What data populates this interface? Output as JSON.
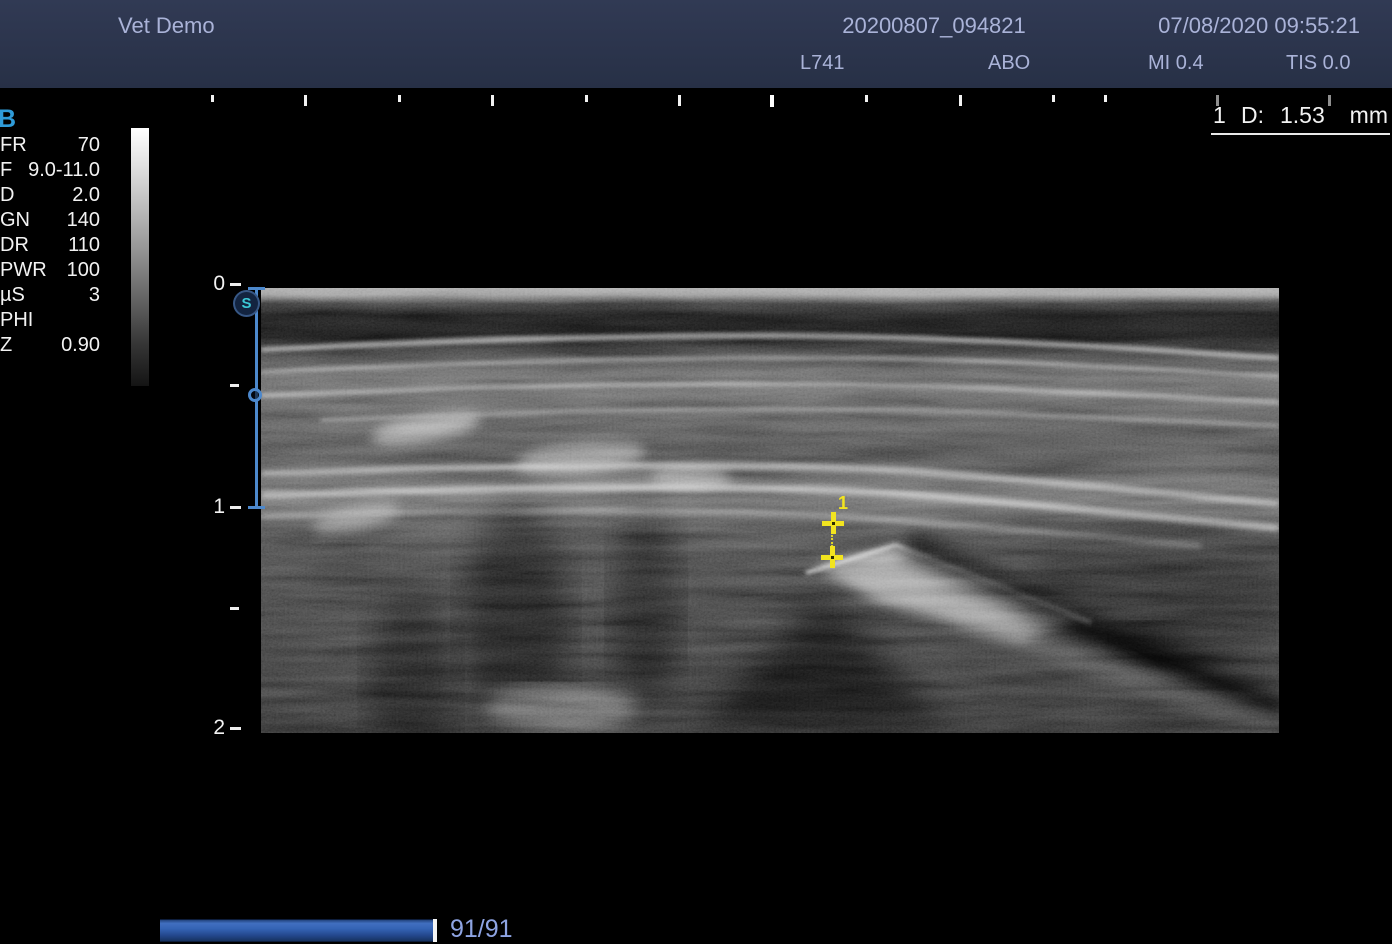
{
  "header": {
    "patient_name": "Vet Demo",
    "exam_id": "20200807_094821",
    "datetime": "07/08/2020 09:55:21",
    "probe": "L741",
    "preset": "ABO",
    "mi": "MI 0.4",
    "tis": "TIS 0.0"
  },
  "measurement": {
    "index": "1",
    "label": "D:",
    "value": "1.53",
    "unit": "mm"
  },
  "params": {
    "mode": "B",
    "rows": [
      {
        "label": "FR",
        "value": "70"
      },
      {
        "label": "F",
        "value": "9.0-11.0"
      },
      {
        "label": "D",
        "value": "2.0"
      },
      {
        "label": "GN",
        "value": "140"
      },
      {
        "label": "DR",
        "value": "110"
      },
      {
        "label": "PWR",
        "value": "100"
      },
      {
        "label": "µS",
        "value": "3"
      },
      {
        "label": "PHI",
        "value": ""
      },
      {
        "label": "Z",
        "value": "0.90"
      }
    ]
  },
  "depth_ruler": {
    "unit_labels": [
      "0",
      "1",
      "2"
    ]
  },
  "orientation_marker": "S",
  "caliper": {
    "label": "1"
  },
  "cine": {
    "counter": "91/91"
  },
  "colors": {
    "header_text": "#aab3d8",
    "mode_blue": "#2f9bd8",
    "focal_blue": "#4c88cc",
    "marker_teal": "#3bc8d6",
    "caliper_yellow": "#f2e41f",
    "cine_text": "#8ea4e3"
  }
}
